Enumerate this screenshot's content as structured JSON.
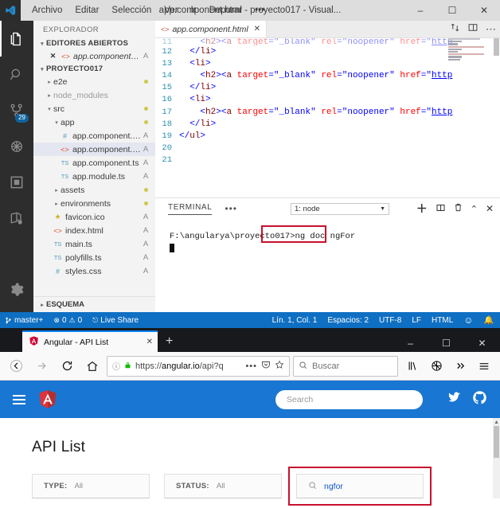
{
  "vscode": {
    "titlebar": {
      "menu": [
        "Archivo",
        "Editar",
        "Selección",
        "Ver",
        "Ir",
        "Depurar",
        "•••"
      ],
      "title": "app.component.html - proyecto017 - Visual...",
      "minimize": "–",
      "maximize": "☐",
      "close": "✕"
    },
    "activitybar": [
      {
        "name": "explorer-icon",
        "badge": null
      },
      {
        "name": "search-icon",
        "badge": null
      },
      {
        "name": "source-control-icon",
        "badge": "29"
      },
      {
        "name": "debug-icon",
        "badge": null
      },
      {
        "name": "extensions-icon",
        "badge": null
      },
      {
        "name": "live-share-icon",
        "badge": null
      }
    ],
    "activitybar_bottom": {
      "name": "settings-gear-icon"
    },
    "sidebar": {
      "title": "EXPLORADOR",
      "open_editors": {
        "label": "EDITORES ABIERTOS",
        "items": [
          {
            "name": "app.component.ht...",
            "status": "A",
            "icon": "html-icon"
          }
        ]
      },
      "project": {
        "label": "PROYECTO017",
        "items": [
          {
            "name": "e2e",
            "status": "dot",
            "icon": "folder",
            "indent": 1,
            "expanded": false
          },
          {
            "name": "node_modules",
            "status": "",
            "icon": "folder",
            "indent": 1,
            "expanded": false,
            "dim": true
          },
          {
            "name": "src",
            "status": "dot",
            "icon": "folder",
            "indent": 1,
            "expanded": true
          },
          {
            "name": "app",
            "status": "dot",
            "icon": "folder",
            "indent": 2,
            "expanded": true
          },
          {
            "name": "app.component.css",
            "status": "A",
            "icon": "css-icon",
            "indent": 3
          },
          {
            "name": "app.component.html",
            "status": "A",
            "icon": "html-icon",
            "indent": 3,
            "selected": true
          },
          {
            "name": "app.component.ts",
            "status": "A",
            "icon": "ts-icon",
            "indent": 3
          },
          {
            "name": "app.module.ts",
            "status": "A",
            "icon": "ts-icon",
            "indent": 3
          },
          {
            "name": "assets",
            "status": "dot",
            "icon": "folder",
            "indent": 2,
            "expanded": false
          },
          {
            "name": "environments",
            "status": "dot",
            "icon": "folder",
            "indent": 2,
            "expanded": false
          },
          {
            "name": "favicon.ico",
            "status": "A",
            "icon": "star-icon",
            "indent": 2
          },
          {
            "name": "index.html",
            "status": "A",
            "icon": "html-icon",
            "indent": 2
          },
          {
            "name": "main.ts",
            "status": "A",
            "icon": "ts-icon",
            "indent": 2
          },
          {
            "name": "polyfills.ts",
            "status": "A",
            "icon": "ts-icon",
            "indent": 2
          },
          {
            "name": "styles.css",
            "status": "A",
            "icon": "css-icon",
            "indent": 2
          }
        ]
      },
      "outline_label": "ESQUEMA"
    },
    "editor": {
      "tab": {
        "filename": "app.component.html",
        "icon": "html-icon",
        "close": "✕"
      },
      "actions": [
        "split-horizontal-icon",
        "split-editor-icon",
        "more-actions-icon"
      ],
      "lines": [
        {
          "num": "11",
          "indent": 2,
          "partial": true,
          "text": "<h2><a target=\"_blank\" rel=\"noopener\" href=\"http"
        },
        {
          "num": "12",
          "indent": 1,
          "text": "</li>"
        },
        {
          "num": "13",
          "indent": 1,
          "text": "<li>"
        },
        {
          "num": "14",
          "indent": 2,
          "text": "<h2><a target=\"_blank\" rel=\"noopener\" href=\"http"
        },
        {
          "num": "15",
          "indent": 1,
          "text": "</li>"
        },
        {
          "num": "16",
          "indent": 1,
          "text": "<li>"
        },
        {
          "num": "17",
          "indent": 2,
          "text": "<h2><a target=\"_blank\" rel=\"noopener\" href=\"http"
        },
        {
          "num": "18",
          "indent": 1,
          "text": "</li>"
        },
        {
          "num": "19",
          "indent": 0,
          "text": "</ul>"
        },
        {
          "num": "20",
          "indent": 0,
          "text": ""
        },
        {
          "num": "21",
          "indent": 0,
          "text": ""
        }
      ]
    },
    "panel": {
      "tab": "TERMINAL",
      "more": "•••",
      "select_value": "1: node",
      "actions": [
        "new-terminal-icon",
        "split-terminal-icon",
        "kill-terminal-icon",
        "maximize-panel-icon",
        "close-panel-icon"
      ],
      "prompt": "F:\\angularya\\proyecto017>",
      "command": "ng doc ngFor"
    },
    "statusbar": {
      "branch": "master+",
      "errors": "0",
      "warnings": "0",
      "live_share": "Live Share",
      "position": "Lín. 1, Col. 1",
      "spaces": "Espacios: 2",
      "encoding": "UTF-8",
      "eol": "LF",
      "language": "HTML",
      "feedback": "☺",
      "bell": "\u0001"
    }
  },
  "firefox": {
    "tab": {
      "title": "Angular - API List",
      "close": "✕",
      "favicon": "angular-icon"
    },
    "newtab_label": "+",
    "wincontrols": {
      "minimize": "–",
      "maximize": "☐",
      "close": "✕"
    },
    "nav": {
      "back": "←",
      "forward": "→",
      "reload": "⟳",
      "home": "⌂"
    },
    "urlbar": {
      "info_icon": "page-info-icon",
      "lock_icon": "lock-icon",
      "url_prefix": "https://",
      "url_domain": "angular.io",
      "url_path": "/api?q",
      "page_actions": "•••",
      "pocket_icon": "pocket-icon",
      "bookmark_icon": "star-icon"
    },
    "searchbar": {
      "placeholder": "Buscar",
      "icon": "search-icon"
    },
    "toolbar_right": [
      "library-icon",
      "account-icon",
      "overflow-icon",
      "menu-icon"
    ]
  },
  "angular_page": {
    "menu_icon": "hamburger-icon",
    "logo": "angular-logo",
    "search_placeholder": "Search",
    "social": [
      "twitter-icon",
      "github-icon"
    ],
    "heading": "API List",
    "filters": [
      {
        "label": "TYPE:",
        "value": "All"
      },
      {
        "label": "STATUS:",
        "value": "All"
      }
    ],
    "search_field": {
      "icon": "search-icon",
      "query": "ngfor"
    }
  },
  "highlights": {
    "color": "#c8102e",
    "terminal_command_box": true,
    "api_search_box": true
  }
}
